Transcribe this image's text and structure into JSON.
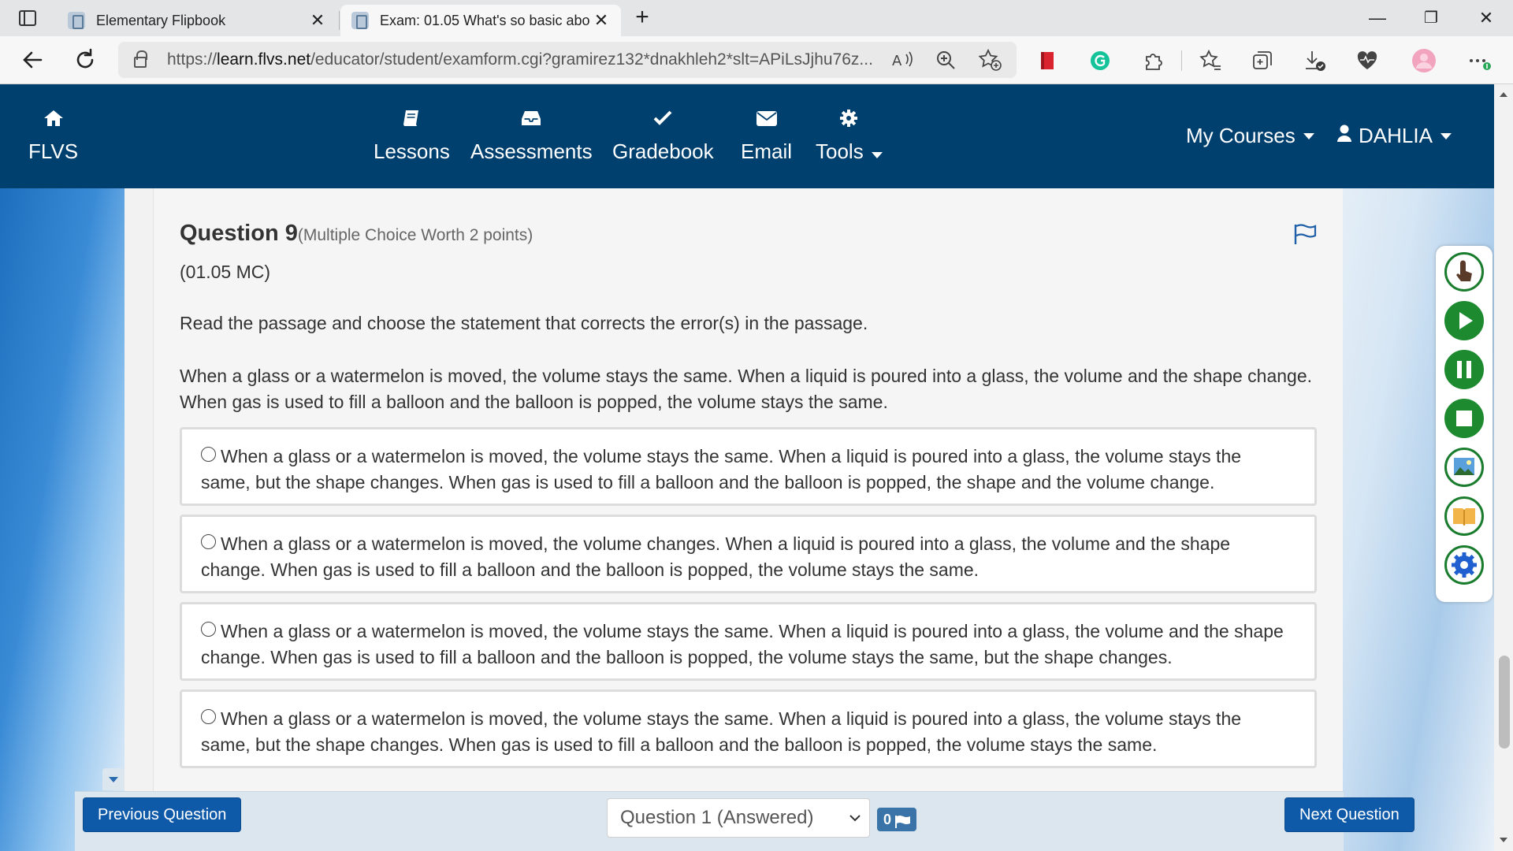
{
  "browser": {
    "tabs": [
      {
        "title": "Elementary Flipbook",
        "active": false
      },
      {
        "title": "Exam: 01.05 What's so basic abo",
        "active": true
      }
    ],
    "close_glyph": "✕",
    "new_tab_glyph": "+",
    "url_prefix": "https://",
    "url_domain": "learn.flvs.net",
    "url_rest": "/educator/student/examform.cgi?gramirez132*dnakhleh2*slt=APiLsJjhu76z...",
    "window_controls": [
      "—",
      "❐",
      "✕"
    ]
  },
  "site_nav": {
    "brand": "FLVS",
    "items": [
      {
        "label": "Lessons"
      },
      {
        "label": "Assessments"
      },
      {
        "label": "Gradebook"
      },
      {
        "label": "Email"
      },
      {
        "label": "Tools"
      }
    ],
    "my_courses": "My Courses",
    "user": "DAHLIA"
  },
  "question": {
    "number_label": "Question 9",
    "worth": "(Multiple Choice Worth 2 points)",
    "code": "(01.05 MC)",
    "prompt": "Read the passage and choose the statement that corrects the error(s) in the passage.",
    "passage": "When a glass or a watermelon is moved, the volume stays the same. When a liquid is poured into a glass, the volume and the shape change. When gas is used to fill a balloon and the balloon is popped, the volume stays the same.",
    "options": [
      "When a glass or a watermelon is moved, the volume stays the same. When a liquid is poured into a glass, the volume stays the same, but the shape changes. When gas is used to fill a balloon and the balloon is popped, the shape and the volume change.",
      "When a glass or a watermelon is moved, the volume changes. When a liquid is poured into a glass, the volume and the shape change. When gas is used to fill a balloon and the balloon is popped, the volume stays the same.",
      "When a glass or a watermelon is moved, the volume stays the same. When a liquid is poured into a glass, the volume and the shape change. When gas is used to fill a balloon and the balloon is popped, the volume stays the same, but the shape changes.",
      "When a glass or a watermelon is moved, the volume stays the same. When a liquid is poured into a glass, the volume stays the same, but the shape changes. When gas is used to fill a balloon and the balloon is popped, the volume stays the same."
    ]
  },
  "footer": {
    "previous": "Previous Question",
    "next": "Next Question",
    "question_select": "Question 1 (Answered)",
    "flag_count": "0"
  },
  "colors": {
    "nav_bg": "#00406f",
    "button_blue": "#0f5aa8",
    "reader_green": "#1d8a30"
  }
}
